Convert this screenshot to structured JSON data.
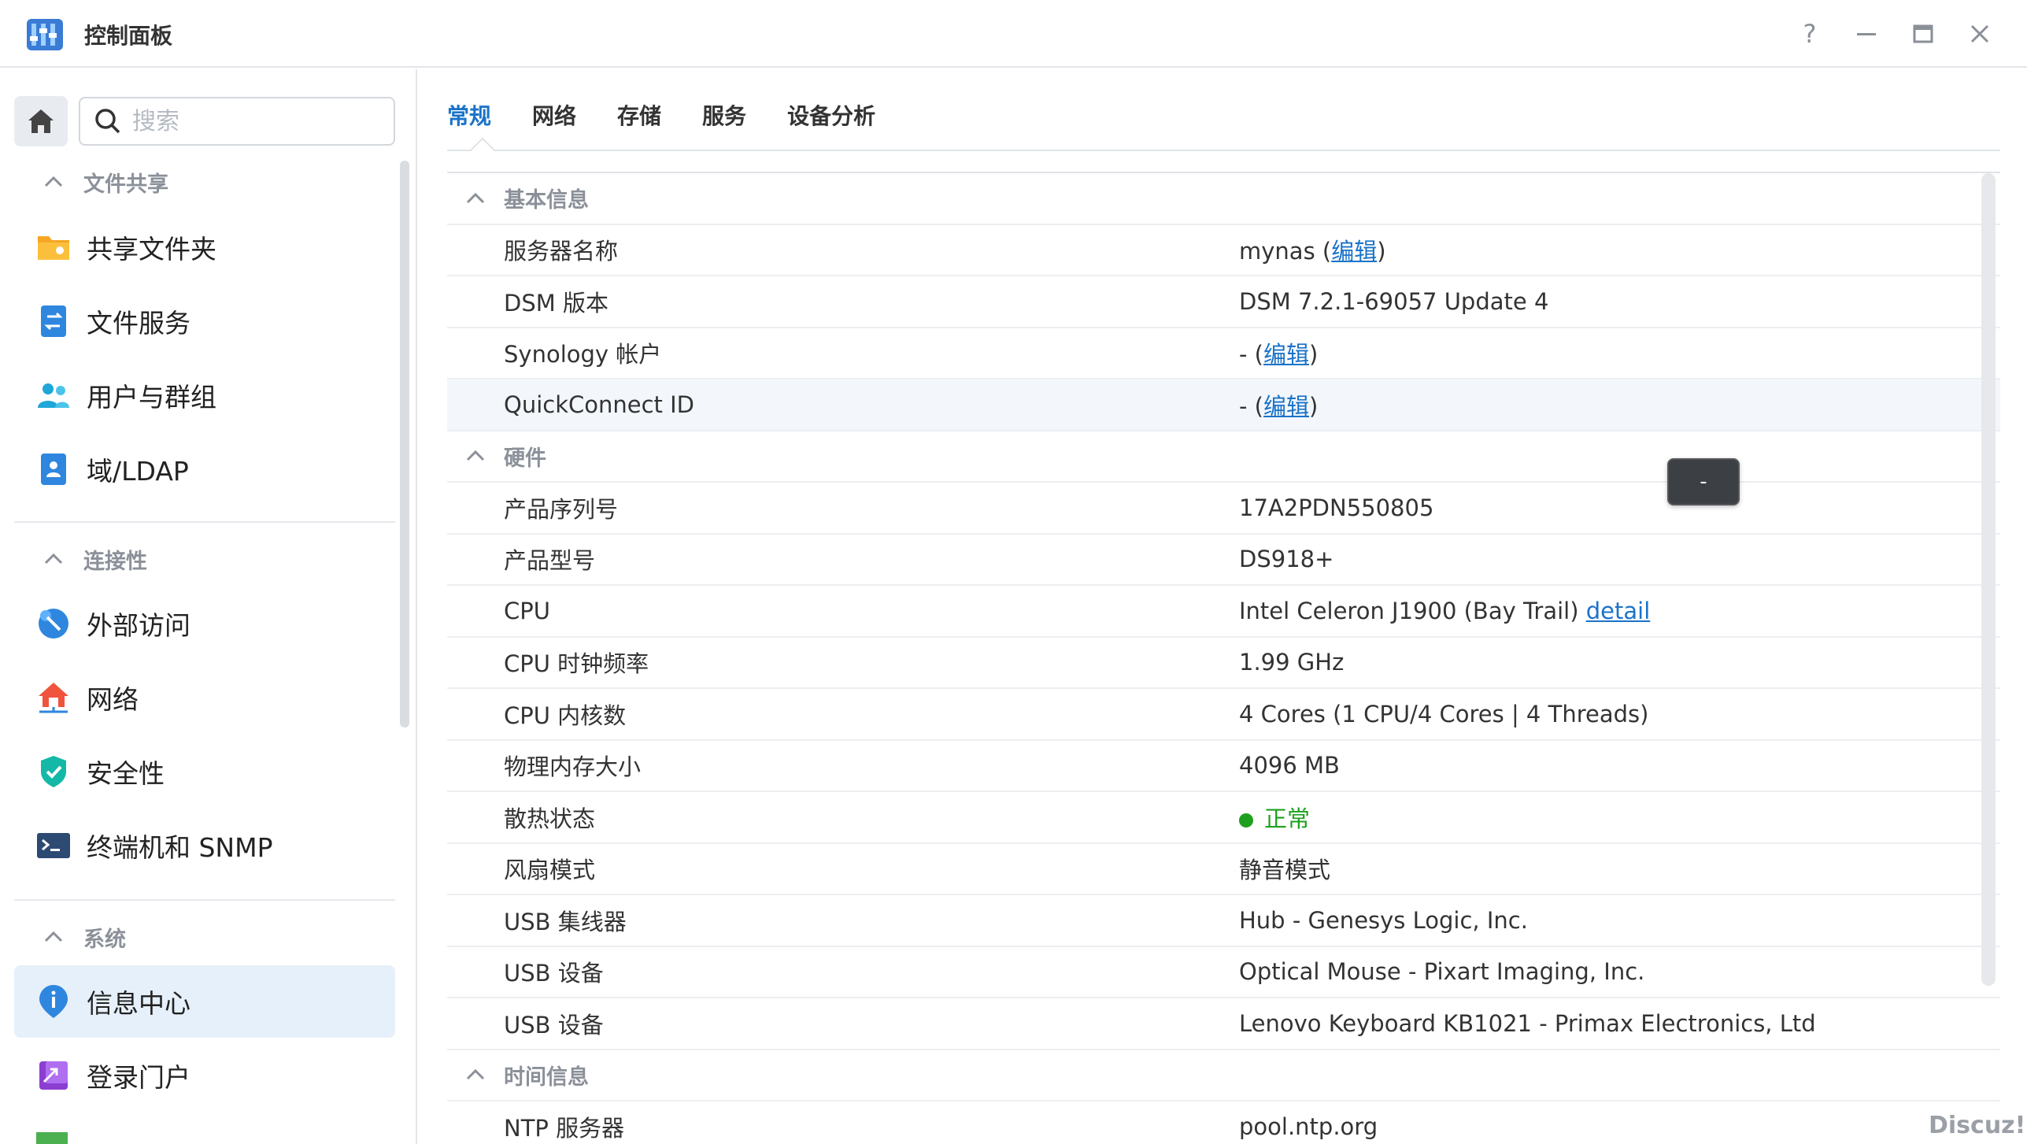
{
  "window": {
    "title": "控制面板",
    "controls": {
      "help": "?",
      "minimize": "—",
      "maximize": "🗖",
      "close": "✕"
    }
  },
  "sidebar": {
    "search_placeholder": "搜索",
    "sections": [
      {
        "label": "文件共享",
        "items": [
          "共享文件夹",
          "文件服务",
          "用户与群组",
          "域/LDAP"
        ]
      },
      {
        "label": "连接性",
        "items": [
          "外部访问",
          "网络",
          "安全性",
          "终端机和 SNMP"
        ]
      },
      {
        "label": "系统",
        "items": [
          "信息中心",
          "登录门户"
        ]
      }
    ],
    "active_item": "信息中心"
  },
  "tabs": [
    "常规",
    "网络",
    "存储",
    "服务",
    "设备分析"
  ],
  "active_tab": "常规",
  "sections": {
    "basic": {
      "title": "基本信息",
      "rows": [
        {
          "key": "服务器名称",
          "value": "mynas",
          "link": "编辑"
        },
        {
          "key": "DSM 版本",
          "value": "DSM 7.2.1-69057 Update 4"
        },
        {
          "key": "Synology 帐户",
          "value": "-",
          "link": "编辑"
        },
        {
          "key": "QuickConnect ID",
          "value": "-",
          "link": "编辑"
        }
      ]
    },
    "hardware": {
      "title": "硬件",
      "rows": [
        {
          "key": "产品序列号",
          "value": "17A2PDN550805"
        },
        {
          "key": "产品型号",
          "value": "DS918+"
        },
        {
          "key": "CPU",
          "value": "Intel Celeron J1900 (Bay Trail)",
          "link": "detail"
        },
        {
          "key": "CPU 时钟频率",
          "value": "1.99 GHz"
        },
        {
          "key": "CPU 内核数",
          "value": "4 Cores (1 CPU/4 Cores | 4 Threads)"
        },
        {
          "key": "物理内存大小",
          "value": "4096 MB"
        },
        {
          "key": "散热状态",
          "value": "正常"
        },
        {
          "key": "风扇模式",
          "value": "静音模式"
        },
        {
          "key": "USB 集线器",
          "value": "Hub - Genesys Logic, Inc."
        },
        {
          "key": "USB 设备",
          "value": "Optical Mouse - Pixart Imaging, Inc."
        },
        {
          "key": "USB 设备",
          "value": "Lenovo Keyboard KB1021 - Primax Electronics, Ltd"
        }
      ]
    },
    "time": {
      "title": "时间信息",
      "rows": [
        {
          "key": "NTP 服务器",
          "value": "pool.ntp.org"
        }
      ]
    }
  },
  "tooltip": "-",
  "watermark": "Discuz!"
}
